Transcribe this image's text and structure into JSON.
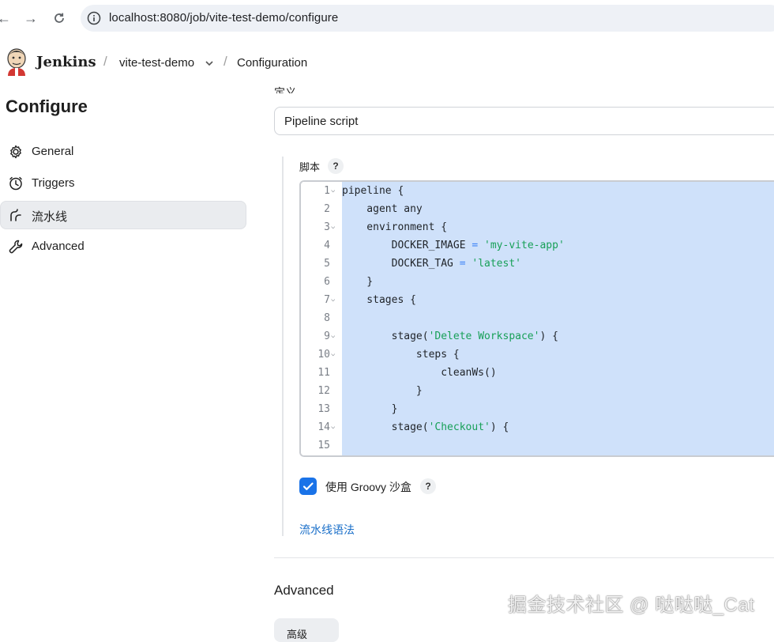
{
  "browser": {
    "url": "localhost:8080/job/vite-test-demo/configure",
    "back_icon": "arrow-left-icon",
    "forward_icon": "arrow-right-icon",
    "reload_icon": "reload-icon",
    "site_info_icon": "info-icon"
  },
  "header": {
    "app_name": "Jenkins",
    "breadcrumbs": [
      "vite-test-demo",
      "Configuration"
    ],
    "separator": "/"
  },
  "sidebar": {
    "title": "Configure",
    "items": [
      {
        "label": "General",
        "icon": "gear-icon",
        "active": false
      },
      {
        "label": "Triggers",
        "icon": "clock-icon",
        "active": false
      },
      {
        "label": "流水线",
        "icon": "pipeline-icon",
        "active": true
      },
      {
        "label": "Advanced",
        "icon": "wrench-icon",
        "active": false
      }
    ]
  },
  "main": {
    "definition_label": "定义",
    "definition_value": "Pipeline script",
    "script_label": "脚本",
    "help": "?",
    "code_lines": [
      {
        "n": "1",
        "fold": true,
        "text": "pipeline {"
      },
      {
        "n": "2",
        "fold": false,
        "text": "    agent any"
      },
      {
        "n": "3",
        "fold": true,
        "text": "    environment {"
      },
      {
        "n": "4",
        "fold": false,
        "text": "        DOCKER_IMAGE = 'my-vite-app'"
      },
      {
        "n": "5",
        "fold": false,
        "text": "        DOCKER_TAG = 'latest'"
      },
      {
        "n": "6",
        "fold": false,
        "text": "    }"
      },
      {
        "n": "7",
        "fold": true,
        "text": "    stages {"
      },
      {
        "n": "8",
        "fold": false,
        "text": ""
      },
      {
        "n": "9",
        "fold": true,
        "text": "        stage('Delete Workspace') {"
      },
      {
        "n": "10",
        "fold": true,
        "text": "            steps {"
      },
      {
        "n": "11",
        "fold": false,
        "text": "                cleanWs()"
      },
      {
        "n": "12",
        "fold": false,
        "text": "            }"
      },
      {
        "n": "13",
        "fold": false,
        "text": "        }"
      },
      {
        "n": "14",
        "fold": true,
        "text": "        stage('Checkout') {"
      },
      {
        "n": "15",
        "fold": false,
        "text": ""
      }
    ],
    "sandbox_label": "使用 Groovy 沙盒",
    "sandbox_checked": true,
    "syntax_link": "流水线语法",
    "advanced_title": "Advanced",
    "advanced_button": "高级"
  },
  "watermark": "掘金技术社区 @ 哒哒哒_Cat",
  "colors": {
    "accent": "#1a73e8",
    "link": "#1a6fc9",
    "selection": "#cfe1fa",
    "string": "#18a058",
    "operator": "#3b82f6"
  }
}
